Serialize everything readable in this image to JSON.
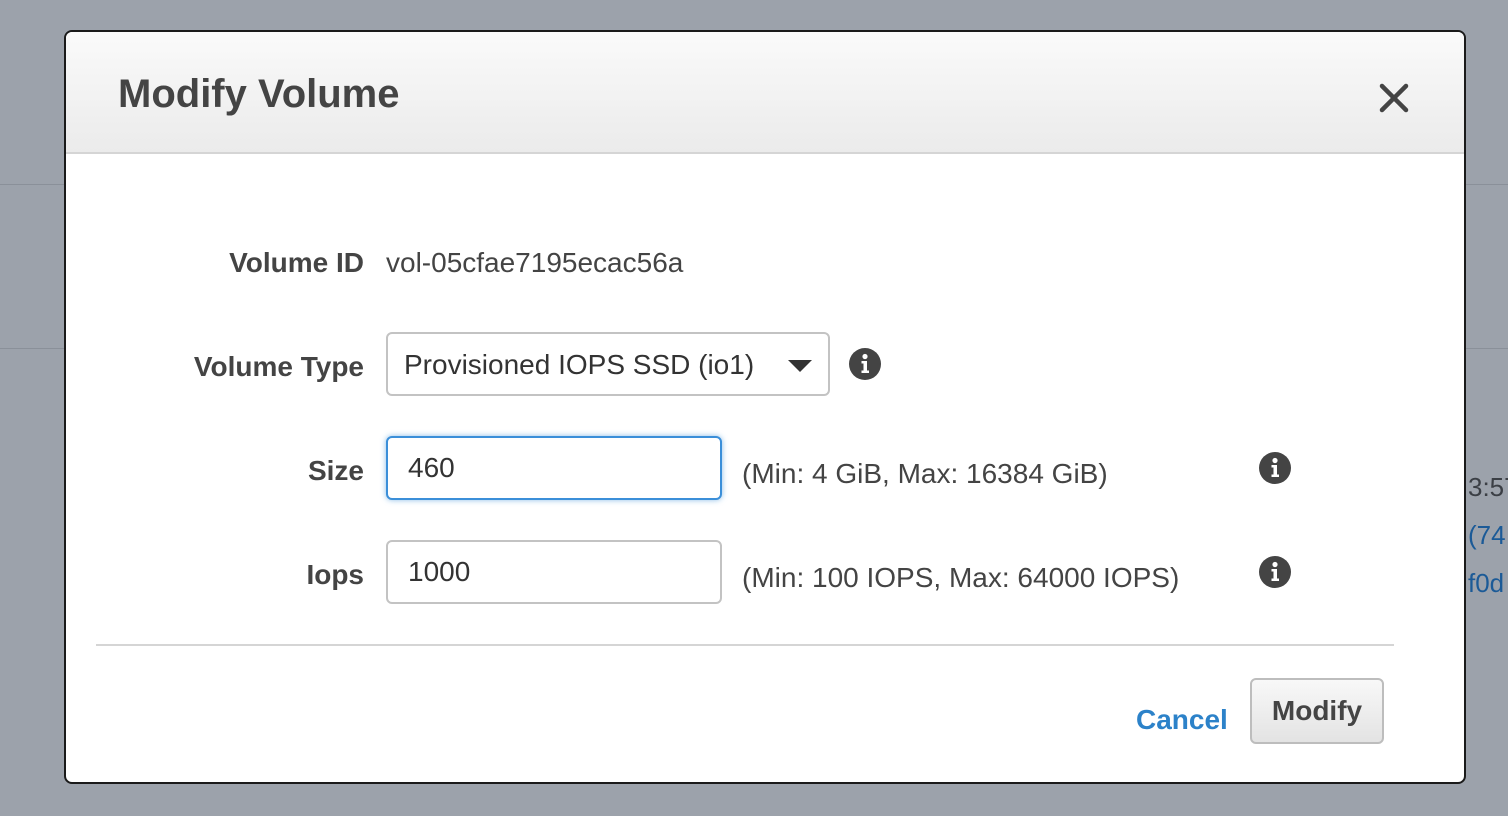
{
  "background": {
    "fragments": [
      "3:57",
      "(74",
      "f0d"
    ]
  },
  "dialog": {
    "title": "Modify Volume",
    "volume_id": {
      "label": "Volume ID",
      "value": "vol-05cfae7195ecac56a"
    },
    "volume_type": {
      "label": "Volume Type",
      "selected": "Provisioned IOPS SSD (io1)"
    },
    "size": {
      "label": "Size",
      "value": "460",
      "hint": "(Min: 4 GiB, Max: 16384 GiB)"
    },
    "iops": {
      "label": "Iops",
      "value": "1000",
      "hint": "(Min: 100 IOPS, Max: 64000 IOPS)"
    },
    "actions": {
      "cancel_label": "Cancel",
      "modify_label": "Modify"
    }
  },
  "colors": {
    "overlay": "#9ca2ab",
    "link": "#2c82c9",
    "focus": "#3b8fd9",
    "label_text": "#444444"
  },
  "icons": [
    "close-icon",
    "info-icon",
    "chevron-down-icon"
  ]
}
